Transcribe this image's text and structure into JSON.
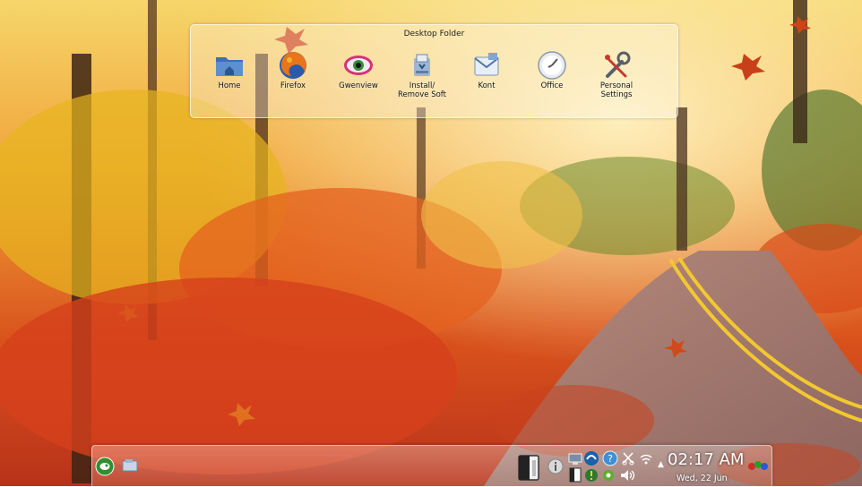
{
  "desktop": {
    "wallpaper": "autumn-forest-road",
    "folder": {
      "title": "Desktop Folder",
      "items": [
        {
          "label": "Home",
          "icon": "home-folder-icon"
        },
        {
          "label": "Firefox",
          "icon": "firefox-icon"
        },
        {
          "label": "Gwenview",
          "icon": "gwenview-eye-icon"
        },
        {
          "label": "Install/\nRemove Soft",
          "icon": "package-installer-icon"
        },
        {
          "label": "Kont",
          "icon": "kontact-icon"
        },
        {
          "label": "Office",
          "icon": "office-icon"
        },
        {
          "label": "Personal\nSettings",
          "icon": "settings-wrench-icon"
        }
      ]
    }
  },
  "panel": {
    "launcher_icon": "opensuse-launcher-icon",
    "clock": {
      "time": "02:17 AM",
      "date": "Wed, 22 Jun"
    }
  },
  "colors": {
    "text_light": "#ffffff",
    "folder_text": "#111111"
  }
}
